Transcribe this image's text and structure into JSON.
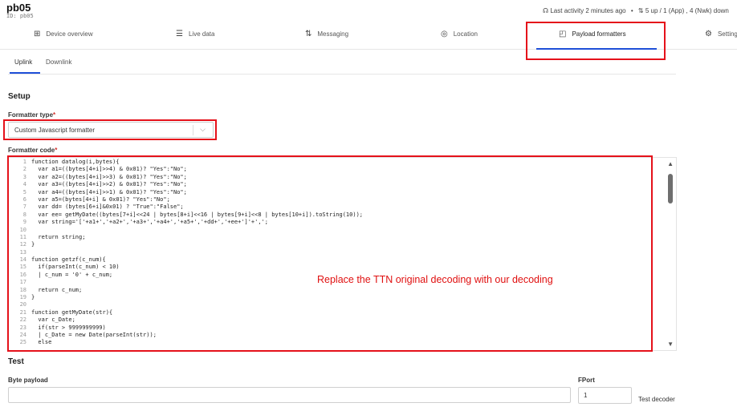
{
  "device": {
    "name": "pb05",
    "id_line": "ID: pb05"
  },
  "activity": {
    "icon": "activity-icon",
    "last_activity": "Last activity 2 minutes ago",
    "separator": "•",
    "frames": "⇅ 5 up / 1 (App) , 4 (Nwk) down"
  },
  "nav": {
    "items": [
      {
        "label": "Device overview",
        "icon": "grid-icon"
      },
      {
        "label": "Live data",
        "icon": "list-icon"
      },
      {
        "label": "Messaging",
        "icon": "arrows-updown-icon"
      },
      {
        "label": "Location",
        "icon": "location-pin-icon"
      },
      {
        "label": "Payload formatters",
        "icon": "code-brackets-icon"
      },
      {
        "label": "Settings",
        "icon": "gear-icon"
      }
    ]
  },
  "subtabs": {
    "uplink": "Uplink",
    "downlink": "Downlink"
  },
  "setup": {
    "title": "Setup",
    "formatter_type_label": "Formatter type",
    "required_mark": "*",
    "formatter_type_value": "Custom Javascript formatter",
    "formatter_code_label": "Formatter code"
  },
  "code": {
    "lines": [
      "function datalog(i,bytes){",
      "  var a1=((bytes[4+i]>>4) & 0x01)? \"Yes\":\"No\";",
      "  var a2=((bytes[4+i]>>3) & 0x01)? \"Yes\":\"No\";",
      "  var a3=((bytes[4+i]>>2) & 0x01)? \"Yes\":\"No\";",
      "  var a4=((bytes[4+i]>>1) & 0x01)? \"Yes\":\"No\";",
      "  var a5=(bytes[4+i] & 0x01)? \"Yes\":\"No\";",
      "  var dd= (bytes[6+i]&0x01) ? \"True\":\"False\";",
      "  var ee= getMyDate((bytes[7+i]<<24 | bytes[8+i]<<16 | bytes[9+i]<<8 | bytes[10+i]).toString(10));",
      "  var string='['+a1+','+a2+','+a3+','+a4+','+a5+','+dd+','+ee+']'+',';",
      "",
      "  return string;",
      "}",
      "",
      "function getzf(c_num){",
      "  if(parseInt(c_num) < 10)",
      "  | c_num = '0' + c_num;",
      "",
      "  return c_num;",
      "}",
      "",
      "function getMyDate(str){",
      "  var c_Date;",
      "  if(str > 9999999999)",
      "  | c_Date = new Date(parseInt(str));",
      "  else"
    ]
  },
  "annotation": "Replace the TTN original decoding with our decoding",
  "test": {
    "title": "Test",
    "byte_payload_label": "Byte payload",
    "byte_payload_value": "",
    "fport_label": "FPort",
    "fport_value": "1",
    "test_decoder_label": "Test decoder"
  },
  "colors": {
    "accent": "#1f4fd8",
    "highlight": "#e5111a",
    "annotation": "#e01010"
  }
}
